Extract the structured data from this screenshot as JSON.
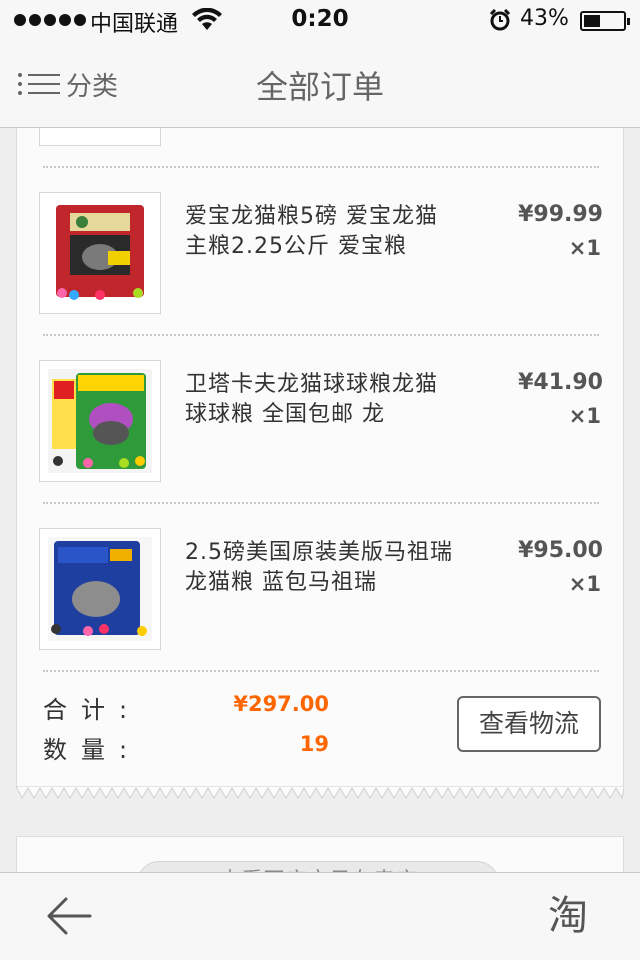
{
  "status_bar": {
    "carrier": "中国联通",
    "time": "0:20",
    "battery_percent": "43%",
    "battery_level": 0.43
  },
  "nav": {
    "menu_label": "分类",
    "title": "全部订单"
  },
  "order": {
    "items": [
      {
        "title": "爱宝龙猫粮5磅  爱宝龙猫主粮2.25公斤 爱宝粮",
        "price": "¥99.99",
        "qty": "×1"
      },
      {
        "title": "卫塔卡夫龙猫球球粮龙猫球球粮 全国包邮  龙",
        "price": "¥41.90",
        "qty": "×1"
      },
      {
        "title": "2.5磅美国原装美版马祖瑞龙猫粮 蓝包马祖瑞",
        "price": "¥95.00",
        "qty": "×1"
      }
    ],
    "total_label": "合计:",
    "total_value": "¥297.00",
    "count_label": "数量:",
    "count_value": "19",
    "logistics_button": "查看物流"
  },
  "next_card": {
    "button_text": "查看同店宝贝在卖店"
  },
  "toolbar": {
    "back_icon": "back-arrow-icon",
    "taobao_label": "淘"
  },
  "colors": {
    "accent": "#ff6600",
    "background": "#eeeeee"
  }
}
